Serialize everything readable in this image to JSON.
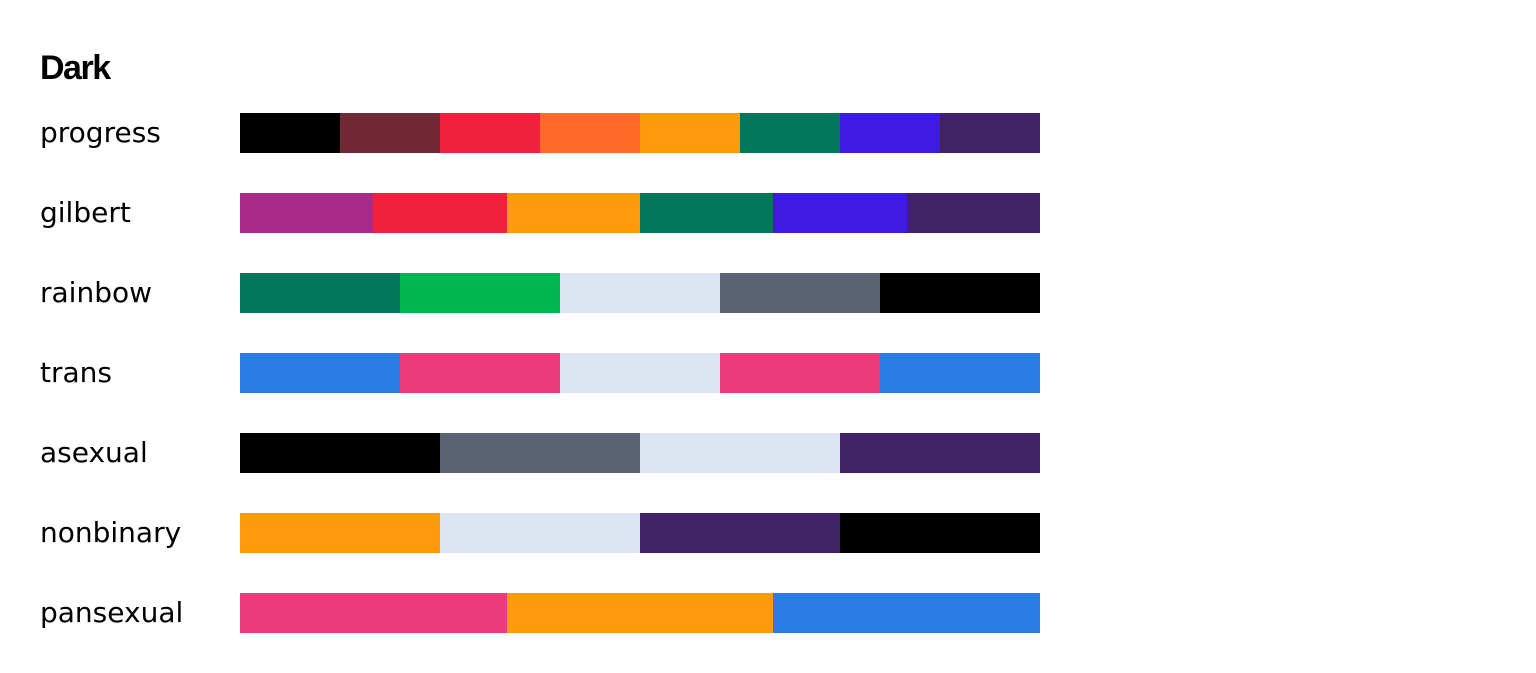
{
  "title": "Dark",
  "palettes": [
    {
      "name": "progress",
      "colors": [
        "#000000",
        "#722936",
        "#f1203d",
        "#ff6a29",
        "#fe9b0b",
        "#00765b",
        "#3c1ae2",
        "#412267"
      ]
    },
    {
      "name": "gilbert",
      "colors": [
        "#a92a89",
        "#f1203d",
        "#fe9b0b",
        "#00765b",
        "#3c1ae2",
        "#412267"
      ]
    },
    {
      "name": "rainbow",
      "colors": [
        "#00765b",
        "#00b650",
        "#dae5f1",
        "#5b6272",
        "#000000"
      ]
    },
    {
      "name": "trans",
      "colors": [
        "#2c7ce6",
        "#eb3d7b",
        "#dae5f1",
        "#eb3d7b",
        "#2c7ce6"
      ]
    },
    {
      "name": "asexual",
      "colors": [
        "#000000",
        "#5b6272",
        "#dae5f1",
        "#412267"
      ]
    },
    {
      "name": "nonbinary",
      "colors": [
        "#fe9b0b",
        "#dae5f1",
        "#412267",
        "#000000"
      ]
    },
    {
      "name": "pansexual",
      "colors": [
        "#eb3d7b",
        "#fe9b0b",
        "#2c7ce6"
      ]
    }
  ]
}
